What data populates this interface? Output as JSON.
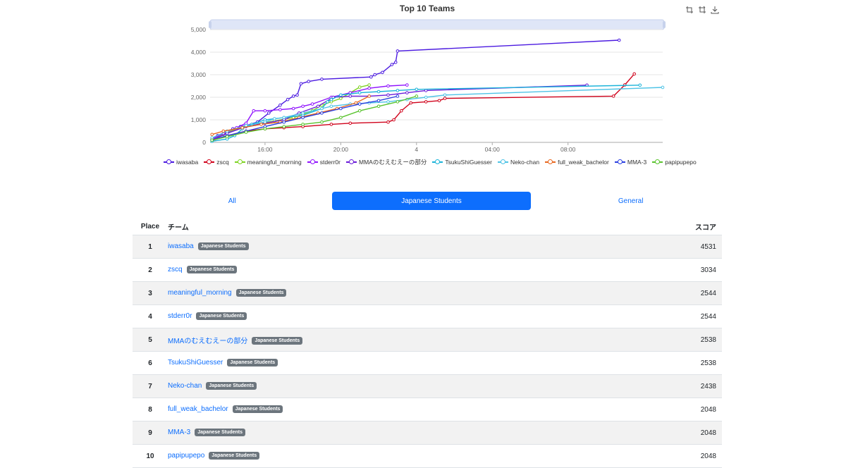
{
  "chart_data": {
    "type": "line",
    "title": "Top 10 Teams",
    "ylim": [
      0,
      5000
    ],
    "y_ticks": [
      "0",
      "1,000",
      "2,000",
      "3,000",
      "4,000",
      "5,000"
    ],
    "x_range_hours": [
      13.1,
      37.0
    ],
    "x_ticks": [
      {
        "label": "16:00",
        "hours": 16
      },
      {
        "label": "20:00",
        "hours": 20
      },
      {
        "label": "4",
        "hours": 24
      },
      {
        "label": "04:00",
        "hours": 28
      },
      {
        "label": "08:00",
        "hours": 32
      }
    ],
    "series": [
      {
        "name": "iwasaba",
        "color": "#4b1ae0",
        "x": [
          13.2,
          13.5,
          13.9,
          14.3,
          14.7,
          15.0,
          15.6,
          16.2,
          16.8,
          17.2,
          17.5,
          17.7,
          17.9,
          18.3,
          19.0,
          21.6,
          21.8,
          22.2,
          22.7,
          22.9,
          23.0,
          34.7
        ],
        "y": [
          120,
          300,
          450,
          600,
          700,
          750,
          900,
          1300,
          1650,
          1900,
          2050,
          2100,
          2600,
          2700,
          2800,
          2900,
          3000,
          3100,
          3450,
          3550,
          4050,
          4531
        ]
      },
      {
        "name": "zscq",
        "color": "#d0021b",
        "x": [
          13.2,
          14.0,
          15.0,
          16.0,
          17.0,
          18.0,
          19.5,
          20.5,
          22.5,
          22.8,
          23.2,
          23.7,
          24.5,
          25.2,
          25.5,
          34.4,
          35.0,
          35.5
        ],
        "y": [
          80,
          300,
          500,
          600,
          650,
          700,
          800,
          850,
          900,
          1000,
          1400,
          1750,
          1800,
          1850,
          1950,
          2050,
          2550,
          3034
        ]
      },
      {
        "name": "meaningful_morning",
        "color": "#7ed321",
        "x": [
          13.2,
          13.8,
          14.5,
          15.5,
          16.5,
          17.5,
          18.5,
          19.0,
          19.5,
          20.0,
          20.5,
          21.0,
          21.5
        ],
        "y": [
          100,
          350,
          600,
          800,
          950,
          1100,
          1400,
          1650,
          1800,
          1950,
          2200,
          2450,
          2544
        ]
      },
      {
        "name": "stderr0r",
        "color": "#9013fe",
        "x": [
          13.2,
          13.8,
          14.5,
          15.0,
          15.4,
          16.0,
          16.8,
          17.5,
          18.0,
          18.5,
          19.5,
          20.5,
          21.5,
          22.5,
          23.5
        ],
        "y": [
          150,
          400,
          650,
          850,
          1400,
          1400,
          1450,
          1500,
          1600,
          1700,
          2000,
          2200,
          2400,
          2500,
          2544
        ]
      },
      {
        "name": "MMAのむえむえーの部分",
        "color": "#6a1bd9",
        "x": [
          13.2,
          14.0,
          15.0,
          16.0,
          17.0,
          17.8,
          18.8,
          19.6,
          20.5,
          21.5,
          22.5,
          23.5,
          24.5,
          33.0
        ],
        "y": [
          100,
          400,
          700,
          850,
          1000,
          1300,
          1600,
          2000,
          2050,
          2050,
          2100,
          2200,
          2300,
          2538
        ]
      },
      {
        "name": "TsukuShiGuesser",
        "color": "#1ab3d9",
        "x": [
          13.2,
          14.0,
          14.4,
          14.8,
          15.3,
          16.0,
          17.0,
          18.0,
          19.0,
          19.3,
          19.5,
          20.0,
          21.0,
          22.0,
          23.0,
          24.0,
          35.8
        ],
        "y": [
          50,
          150,
          300,
          600,
          800,
          1000,
          1100,
          1200,
          1500,
          1800,
          1900,
          2100,
          2200,
          2250,
          2300,
          2350,
          2538
        ]
      },
      {
        "name": "Neko-chan",
        "color": "#4ec3e6",
        "x": [
          13.2,
          14.0,
          15.0,
          16.0,
          16.5,
          17.0,
          18.0,
          19.0,
          19.5,
          20.5,
          21.5,
          22.5,
          23.5,
          24.5,
          25.5,
          37.0
        ],
        "y": [
          200,
          500,
          750,
          900,
          1050,
          1100,
          1300,
          1500,
          1600,
          1700,
          1750,
          1800,
          1900,
          2000,
          2100,
          2438
        ]
      },
      {
        "name": "full_weak_bachelor",
        "color": "#e8671f",
        "x": [
          13.2,
          13.8,
          14.8,
          15.8,
          16.8,
          17.8,
          18.8,
          19.8,
          20.8,
          21.5
        ],
        "y": [
          350,
          500,
          650,
          800,
          900,
          1100,
          1300,
          1500,
          1750,
          2048
        ]
      },
      {
        "name": "MMA-3",
        "color": "#2a3fe0",
        "x": [
          13.2,
          14.0,
          15.0,
          16.0,
          17.0,
          18.0,
          19.0,
          20.0,
          21.0,
          22.0,
          23.0
        ],
        "y": [
          100,
          300,
          500,
          700,
          900,
          1100,
          1300,
          1500,
          1700,
          1850,
          2048
        ]
      },
      {
        "name": "papipupepo",
        "color": "#59c32e",
        "x": [
          13.2,
          14.0,
          15.0,
          16.0,
          17.0,
          18.0,
          19.0,
          20.0,
          21.0,
          22.0,
          23.0,
          24.0
        ],
        "y": [
          100,
          250,
          450,
          600,
          700,
          800,
          900,
          1100,
          1400,
          1600,
          1800,
          2048
        ]
      }
    ]
  },
  "tabs": {
    "all": "All",
    "japanese_students": "Japanese Students",
    "general": "General"
  },
  "table": {
    "headers": {
      "place": "Place",
      "team": "チーム",
      "score": "スコア"
    },
    "rows": [
      {
        "place": "1",
        "team": "iwasaba",
        "badge": "Japanese Students",
        "score": "4531"
      },
      {
        "place": "2",
        "team": "zscq",
        "badge": "Japanese Students",
        "score": "3034"
      },
      {
        "place": "3",
        "team": "meaningful_morning",
        "badge": "Japanese Students",
        "score": "2544"
      },
      {
        "place": "4",
        "team": "stderr0r",
        "badge": "Japanese Students",
        "score": "2544"
      },
      {
        "place": "5",
        "team": "MMAのむえむえーの部分",
        "badge": "Japanese Students",
        "score": "2538"
      },
      {
        "place": "6",
        "team": "TsukuShiGuesser",
        "badge": "Japanese Students",
        "score": "2538"
      },
      {
        "place": "7",
        "team": "Neko-chan",
        "badge": "Japanese Students",
        "score": "2438"
      },
      {
        "place": "8",
        "team": "full_weak_bachelor",
        "badge": "Japanese Students",
        "score": "2048"
      },
      {
        "place": "9",
        "team": "MMA-3",
        "badge": "Japanese Students",
        "score": "2048"
      },
      {
        "place": "10",
        "team": "papipupepo",
        "badge": "Japanese Students",
        "score": "2048"
      }
    ]
  },
  "toolbox": {
    "icons": [
      "zoom-icon",
      "zoom-reset-icon",
      "save-image-icon"
    ]
  }
}
